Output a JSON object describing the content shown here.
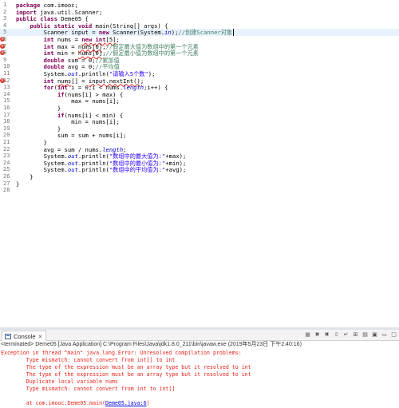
{
  "editor": {
    "lines": [
      {
        "n": "1",
        "html": "<span class=\"kw\">package</span> com.imooc;"
      },
      {
        "n": "2",
        "html": "<span class=\"kw\">import</span> java.util.Scanner;"
      },
      {
        "n": "3",
        "html": "<span class=\"kw\">public</span> <span class=\"kw\">class</span> Deme05 {"
      },
      {
        "n": "4",
        "html": "    <span class=\"kw\">public</span> <span class=\"kw\">static</span> <span class=\"kw\">void</span> main(String[] args) {"
      },
      {
        "n": "5",
        "html": "        Scanner input = <span class=\"kw\">new</span> Scanner(System.<span class=\"fld\">in</span>);<span class=\"cmt\">//创建Scanner对象</span><span class=\"cur\"></span>",
        "highlight": true
      },
      {
        "n": "6",
        "html": "        <span class=\"kw\">int</span> nums = <span class=\"err\"><span class=\"kw\">new</span> <span class=\"kw\">int</span>[5]</span>;",
        "marker": "error"
      },
      {
        "n": "7",
        "html": "        <span class=\"kw\">int</span> max = <span class=\"err\">nums[0]</span>;<span class=\"cmt\">//假定最大值为数组中的第一个元素</span>",
        "marker": "error"
      },
      {
        "n": "8",
        "html": "        <span class=\"kw\">int</span> min = <span class=\"err\">nums[0]</span>;<span class=\"cmt\">//假定最小值为数组中的第一个元素</span>",
        "marker": "error"
      },
      {
        "n": "9",
        "html": "        <span class=\"kw\">double</span> sum = 0;<span class=\"cmt\">//累加值</span>"
      },
      {
        "n": "10",
        "html": "        <span class=\"kw\">double</span> avg = 0;<span class=\"cmt\">//平均值</span>"
      },
      {
        "n": "11",
        "html": "        System.<span class=\"fld\">out</span>.println(<span class=\"str\">\"请输入5个数\"</span>);"
      },
      {
        "n": "12",
        "html": "        <span class=\"kw\">int</span> <span class=\"err\">nums</span>[] = <span class=\"err\">input.nextInt()</span>;",
        "marker": "error"
      },
      {
        "n": "13",
        "html": "        <span class=\"kw\">for</span>(<span class=\"kw\">int</span> i = 0;i &lt; nums.<span class=\"fld\">length</span>;i++) {"
      },
      {
        "n": "14",
        "html": "            <span class=\"kw\">if</span>(nums[i] &gt; max) {"
      },
      {
        "n": "15",
        "html": "                max = nums[i];"
      },
      {
        "n": "16",
        "html": "            }"
      },
      {
        "n": "17",
        "html": "            <span class=\"kw\">if</span>(nums[i] &lt; min) {"
      },
      {
        "n": "18",
        "html": "                min = nums[i];"
      },
      {
        "n": "19",
        "html": "            }"
      },
      {
        "n": "20",
        "html": "            sum = sum + nums[i];"
      },
      {
        "n": "21",
        "html": "        }"
      },
      {
        "n": "22",
        "html": "        avg = sum / nums.<span class=\"fld\">length</span>;"
      },
      {
        "n": "23",
        "html": "        System.<span class=\"fld\">out</span>.println(<span class=\"str\">\"数组中的最大值为:\"</span>+max);"
      },
      {
        "n": "24",
        "html": "        System.<span class=\"fld\">out</span>.println(<span class=\"str\">\"数组中的最小值为:\"</span>+min);"
      },
      {
        "n": "25",
        "html": "        System.<span class=\"fld\">out</span>.println(<span class=\"str\">\"数组中的平均值为:\"</span>+avg);"
      },
      {
        "n": "26",
        "html": "    }"
      },
      {
        "n": "27",
        "html": "}"
      },
      {
        "n": "28",
        "html": ""
      }
    ]
  },
  "console": {
    "tab_label": "Console",
    "tab_close": "✕",
    "toolbar_icons": [
      "stop-icon",
      "remove-launch-icon",
      "remove-all-icon",
      "scroll-lock-icon",
      "word-wrap-icon",
      "pin-icon",
      "display-console-icon",
      "open-console-icon",
      "minimize-icon",
      "maximize-icon"
    ],
    "toolbar_glyphs": [
      "■",
      "✖",
      "✖",
      "⇩",
      "↵",
      "⊞",
      "▤",
      "▣",
      "▭",
      "□"
    ],
    "terminated": "<terminated> Deme05 [Java Application] C:\\Program Files\\Java\\jdk1.8.0_211\\bin\\javaw.exe (2019年5月23日 下午2:40:16)",
    "output": [
      "Exception in thread \"main\" java.lang.Error: Unresolved compilation problems: ",
      "\tType mismatch: cannot convert from int[] to int",
      "\tThe type of the expression must be an array type but it resolved to int",
      "\tThe type of the expression must be an array type but it resolved to int",
      "\tDuplicate local variable nums",
      "\tType mismatch: cannot convert from int to int[]",
      "",
      "\tat com.imooc.Deme05.main("
    ],
    "link": "Deme05.java:6",
    "link_suffix": ")"
  }
}
